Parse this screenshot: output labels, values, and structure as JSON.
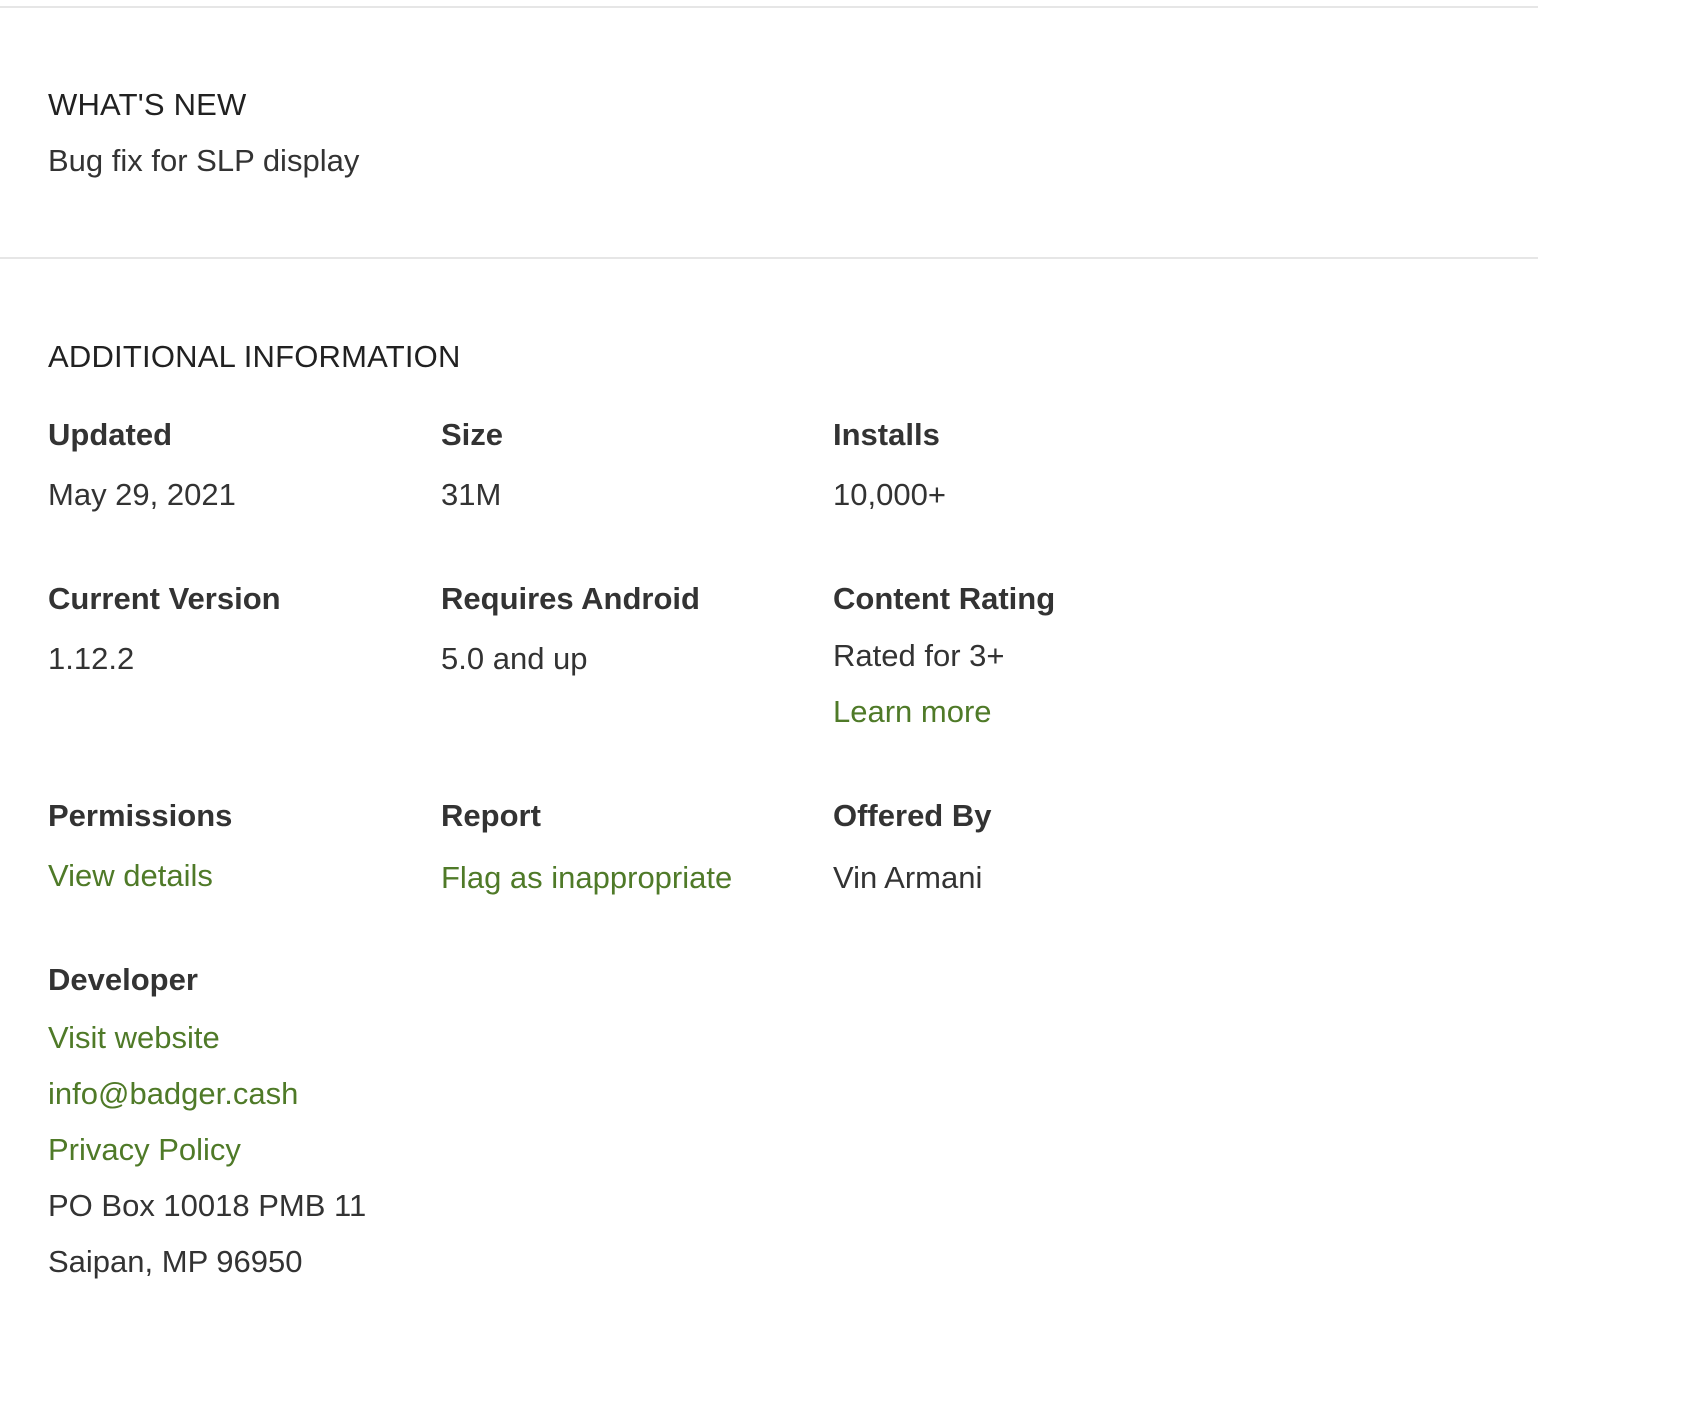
{
  "whats_new": {
    "title": "WHAT'S NEW",
    "body": "Bug fix for SLP display"
  },
  "additional_info": {
    "title": "ADDITIONAL INFORMATION",
    "updated": {
      "label": "Updated",
      "value": "May 29, 2021"
    },
    "size": {
      "label": "Size",
      "value": "31M"
    },
    "installs": {
      "label": "Installs",
      "value": "10,000+"
    },
    "current_version": {
      "label": "Current Version",
      "value": "1.12.2"
    },
    "requires_android": {
      "label": "Requires Android",
      "value": "5.0 and up"
    },
    "content_rating": {
      "label": "Content Rating",
      "value": "Rated for 3+",
      "link": "Learn more"
    },
    "permissions": {
      "label": "Permissions",
      "link": "View details"
    },
    "report": {
      "label": "Report",
      "link": "Flag as inappropriate"
    },
    "offered_by": {
      "label": "Offered By",
      "value": "Vin Armani"
    },
    "developer": {
      "label": "Developer",
      "website_link": "Visit website",
      "email_link": "info@badger.cash",
      "privacy_link": "Privacy Policy",
      "address_line1": "PO Box 10018 PMB 11",
      "address_line2": "Saipan, MP 96950"
    }
  },
  "colors": {
    "link": "#4f7a28",
    "text": "#333333",
    "divider": "#e6e6e6"
  }
}
